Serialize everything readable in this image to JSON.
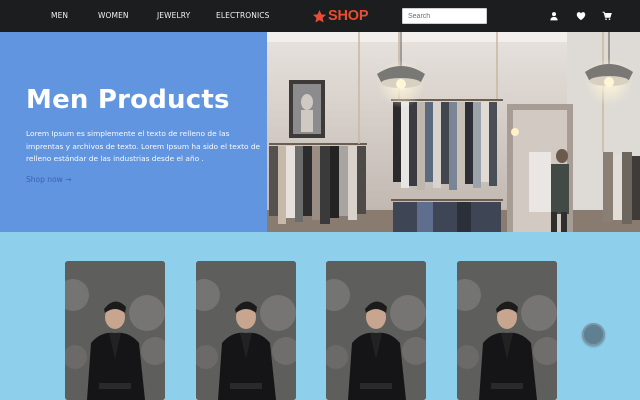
{
  "nav": {
    "links": [
      "MEN",
      "WOMEN",
      "JEWELRY",
      "ELECTRONICS"
    ],
    "logo": "SHOP",
    "search_placeholder": "Search",
    "icons": [
      "user-icon",
      "heart-icon",
      "cart-icon"
    ]
  },
  "hero": {
    "title": "Men Products",
    "text": "Lorem Ipsum es simplemente el texto de relleno de las imprentas y archivos de texto. Lorem Ipsum ha sido el texto de relleno estándar de las industrias desde el año .",
    "link": "Shop now →"
  },
  "colors": {
    "navbar": "#1b1d1e",
    "hero_panel": "#6195e0",
    "page_background": "#8ed0ec",
    "logo": "#ea4d35",
    "link": "#3d5fb6"
  }
}
